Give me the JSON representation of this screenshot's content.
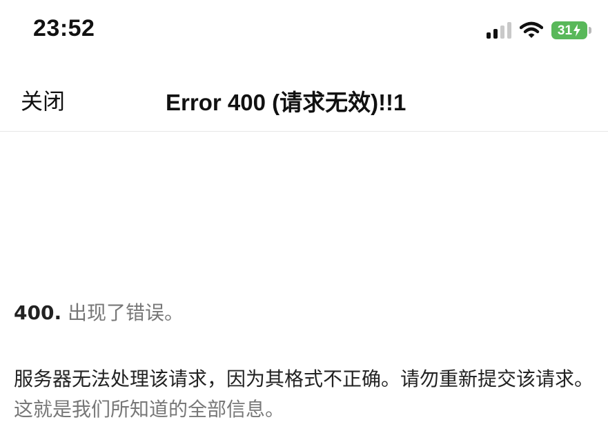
{
  "status_bar": {
    "time": "23:52",
    "battery_level": "31",
    "signal_bars_active": 2,
    "signal_bars_total": 4,
    "battery_color": "#59b85a"
  },
  "nav": {
    "close_label": "关闭",
    "title": "Error 400 (请求无效)!!1"
  },
  "error": {
    "code": "400.",
    "short_message": "出现了错误。",
    "description": "服务器无法处理该请求，因为其格式不正确。请勿重新提交该请求。",
    "description_muted": "这就是我们所知道的全部信息。"
  },
  "icons": {
    "signal": "cellular-signal-icon",
    "wifi": "wifi-icon",
    "battery": "battery-charging-icon"
  }
}
